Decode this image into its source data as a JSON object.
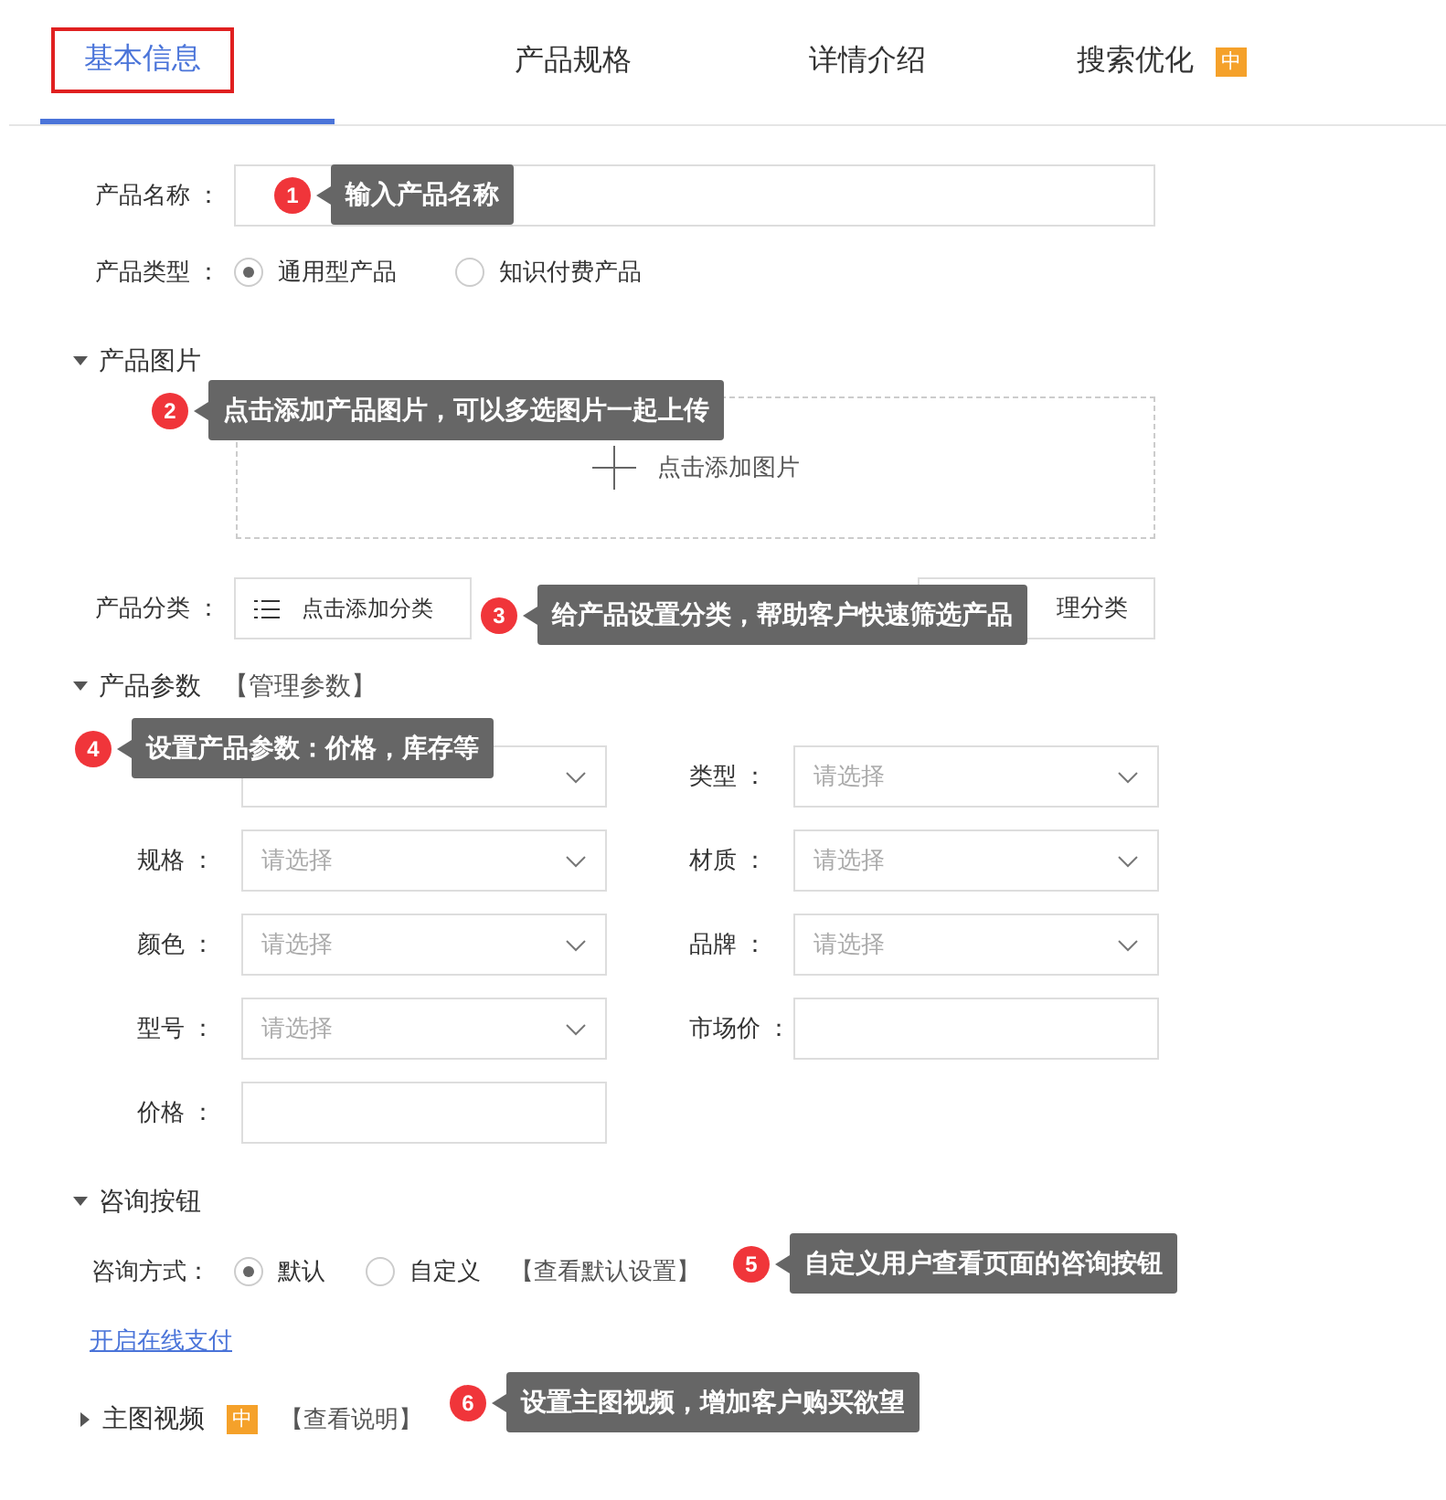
{
  "tabs": [
    {
      "label": "基本信息",
      "selected": true
    },
    {
      "label": "产品规格",
      "selected": false
    },
    {
      "label": "详情介绍",
      "selected": false
    },
    {
      "label": "搜索优化",
      "selected": false,
      "badge": "中"
    }
  ],
  "product_name": {
    "label": "产品名称 ："
  },
  "product_type": {
    "label": "产品类型 ：",
    "options": [
      {
        "label": "通用型产品",
        "selected": true
      },
      {
        "label": "知识付费产品",
        "selected": false
      }
    ]
  },
  "images": {
    "title": "产品图片",
    "expanded": true,
    "upload": "点击添加图片"
  },
  "category": {
    "label": "产品分类 ：",
    "add_button": "点击添加分类",
    "manage_button": "理分类"
  },
  "params": {
    "title": "产品参数",
    "expanded": true,
    "link": "【管理参数】",
    "fields": [
      {
        "kind": "select"
      },
      {
        "kind": "select",
        "label": "类型 ：",
        "placeholder": "请选择"
      },
      {
        "kind": "select",
        "label": "规格 ：",
        "placeholder": "请选择"
      },
      {
        "kind": "select",
        "label": "材质 ：",
        "placeholder": "请选择"
      },
      {
        "kind": "select",
        "label": "颜色 ：",
        "placeholder": "请选择"
      },
      {
        "kind": "select",
        "label": "品牌 ：",
        "placeholder": "请选择"
      },
      {
        "kind": "select",
        "label": "型号 ：",
        "placeholder": "请选择"
      },
      {
        "kind": "input",
        "label": "市场价 ："
      },
      {
        "kind": "input",
        "label": "价格 ："
      }
    ]
  },
  "consult": {
    "title": "咨询按钮",
    "expanded": true,
    "label": "咨询方式：",
    "options": [
      {
        "label": "默认",
        "selected": true
      },
      {
        "label": "自定义",
        "selected": false
      }
    ],
    "link": "【查看默认设置】"
  },
  "payment_link": "开启在线支付",
  "video": {
    "title": "主图视频",
    "expanded": false,
    "badge": "中",
    "link": "【查看说明】"
  },
  "callouts": [
    {
      "number": "1",
      "text": "输入产品名称"
    },
    {
      "number": "2",
      "text": "点击添加产品图片，可以多选图片一起上传"
    },
    {
      "number": "3",
      "text": "给产品设置分类，帮助客户快速筛选产品"
    },
    {
      "number": "4",
      "text": "设置产品参数：价格，库存等"
    },
    {
      "number": "5",
      "text": "自定义用户查看页面的咨询按钮"
    },
    {
      "number": "6",
      "text": "设置主图视频，增加客户购买欲望"
    }
  ]
}
